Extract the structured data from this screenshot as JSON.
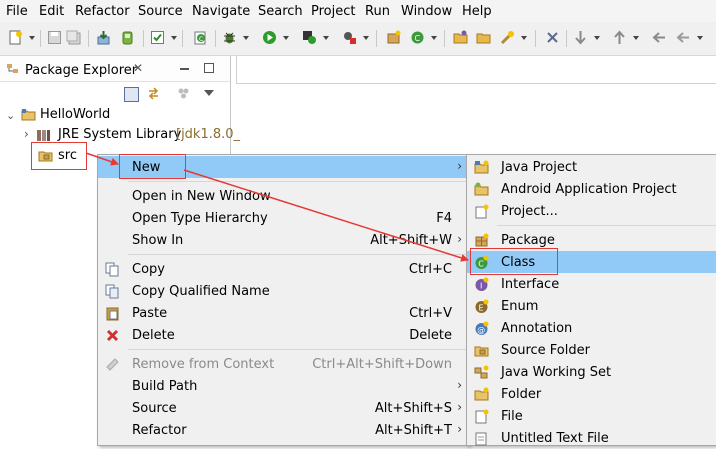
{
  "menubar": {
    "items": [
      "File",
      "Edit",
      "Refactor",
      "Source",
      "Navigate",
      "Search",
      "Project",
      "Run",
      "Window",
      "Help"
    ]
  },
  "panel": {
    "title": "Package Explorer",
    "tree": {
      "project": "HelloWorld",
      "library": "JRE System Library",
      "library_suffix": "[jdk1.8.0_",
      "folder": "src"
    }
  },
  "context_menu": {
    "items": [
      {
        "label": "New",
        "shortcut": ""
      },
      {
        "label": "Open in New Window",
        "shortcut": ""
      },
      {
        "label": "Open Type Hierarchy",
        "shortcut": "F4"
      },
      {
        "label": "Show In",
        "shortcut": "Alt+Shift+W"
      },
      {
        "label": "Copy",
        "shortcut": "Ctrl+C"
      },
      {
        "label": "Copy Qualified Name",
        "shortcut": ""
      },
      {
        "label": "Paste",
        "shortcut": "Ctrl+V"
      },
      {
        "label": "Delete",
        "shortcut": "Delete"
      },
      {
        "label": "Remove from Context",
        "shortcut": "Ctrl+Alt+Shift+Down"
      },
      {
        "label": "Build Path",
        "shortcut": ""
      },
      {
        "label": "Source",
        "shortcut": "Alt+Shift+S"
      },
      {
        "label": "Refactor",
        "shortcut": "Alt+Shift+T"
      }
    ]
  },
  "submenu": {
    "items": [
      {
        "label": "Java Project",
        "icon": "java-project-icon"
      },
      {
        "label": "Android Application Project",
        "icon": "android-project-icon"
      },
      {
        "label": "Project...",
        "icon": "project-icon"
      },
      {
        "label": "Package",
        "icon": "package-icon"
      },
      {
        "label": "Class",
        "icon": "class-icon"
      },
      {
        "label": "Interface",
        "icon": "interface-icon"
      },
      {
        "label": "Enum",
        "icon": "enum-icon"
      },
      {
        "label": "Annotation",
        "icon": "annotation-icon"
      },
      {
        "label": "Source Folder",
        "icon": "source-folder-icon"
      },
      {
        "label": "Java Working Set",
        "icon": "working-set-icon"
      },
      {
        "label": "Folder",
        "icon": "folder-icon"
      },
      {
        "label": "File",
        "icon": "file-icon"
      },
      {
        "label": "Untitled Text File",
        "icon": "text-file-icon"
      }
    ]
  },
  "colors": {
    "highlight": "#91c9f7",
    "annotation_red": "#e53935",
    "menu_bg": "#f0f0f0"
  }
}
